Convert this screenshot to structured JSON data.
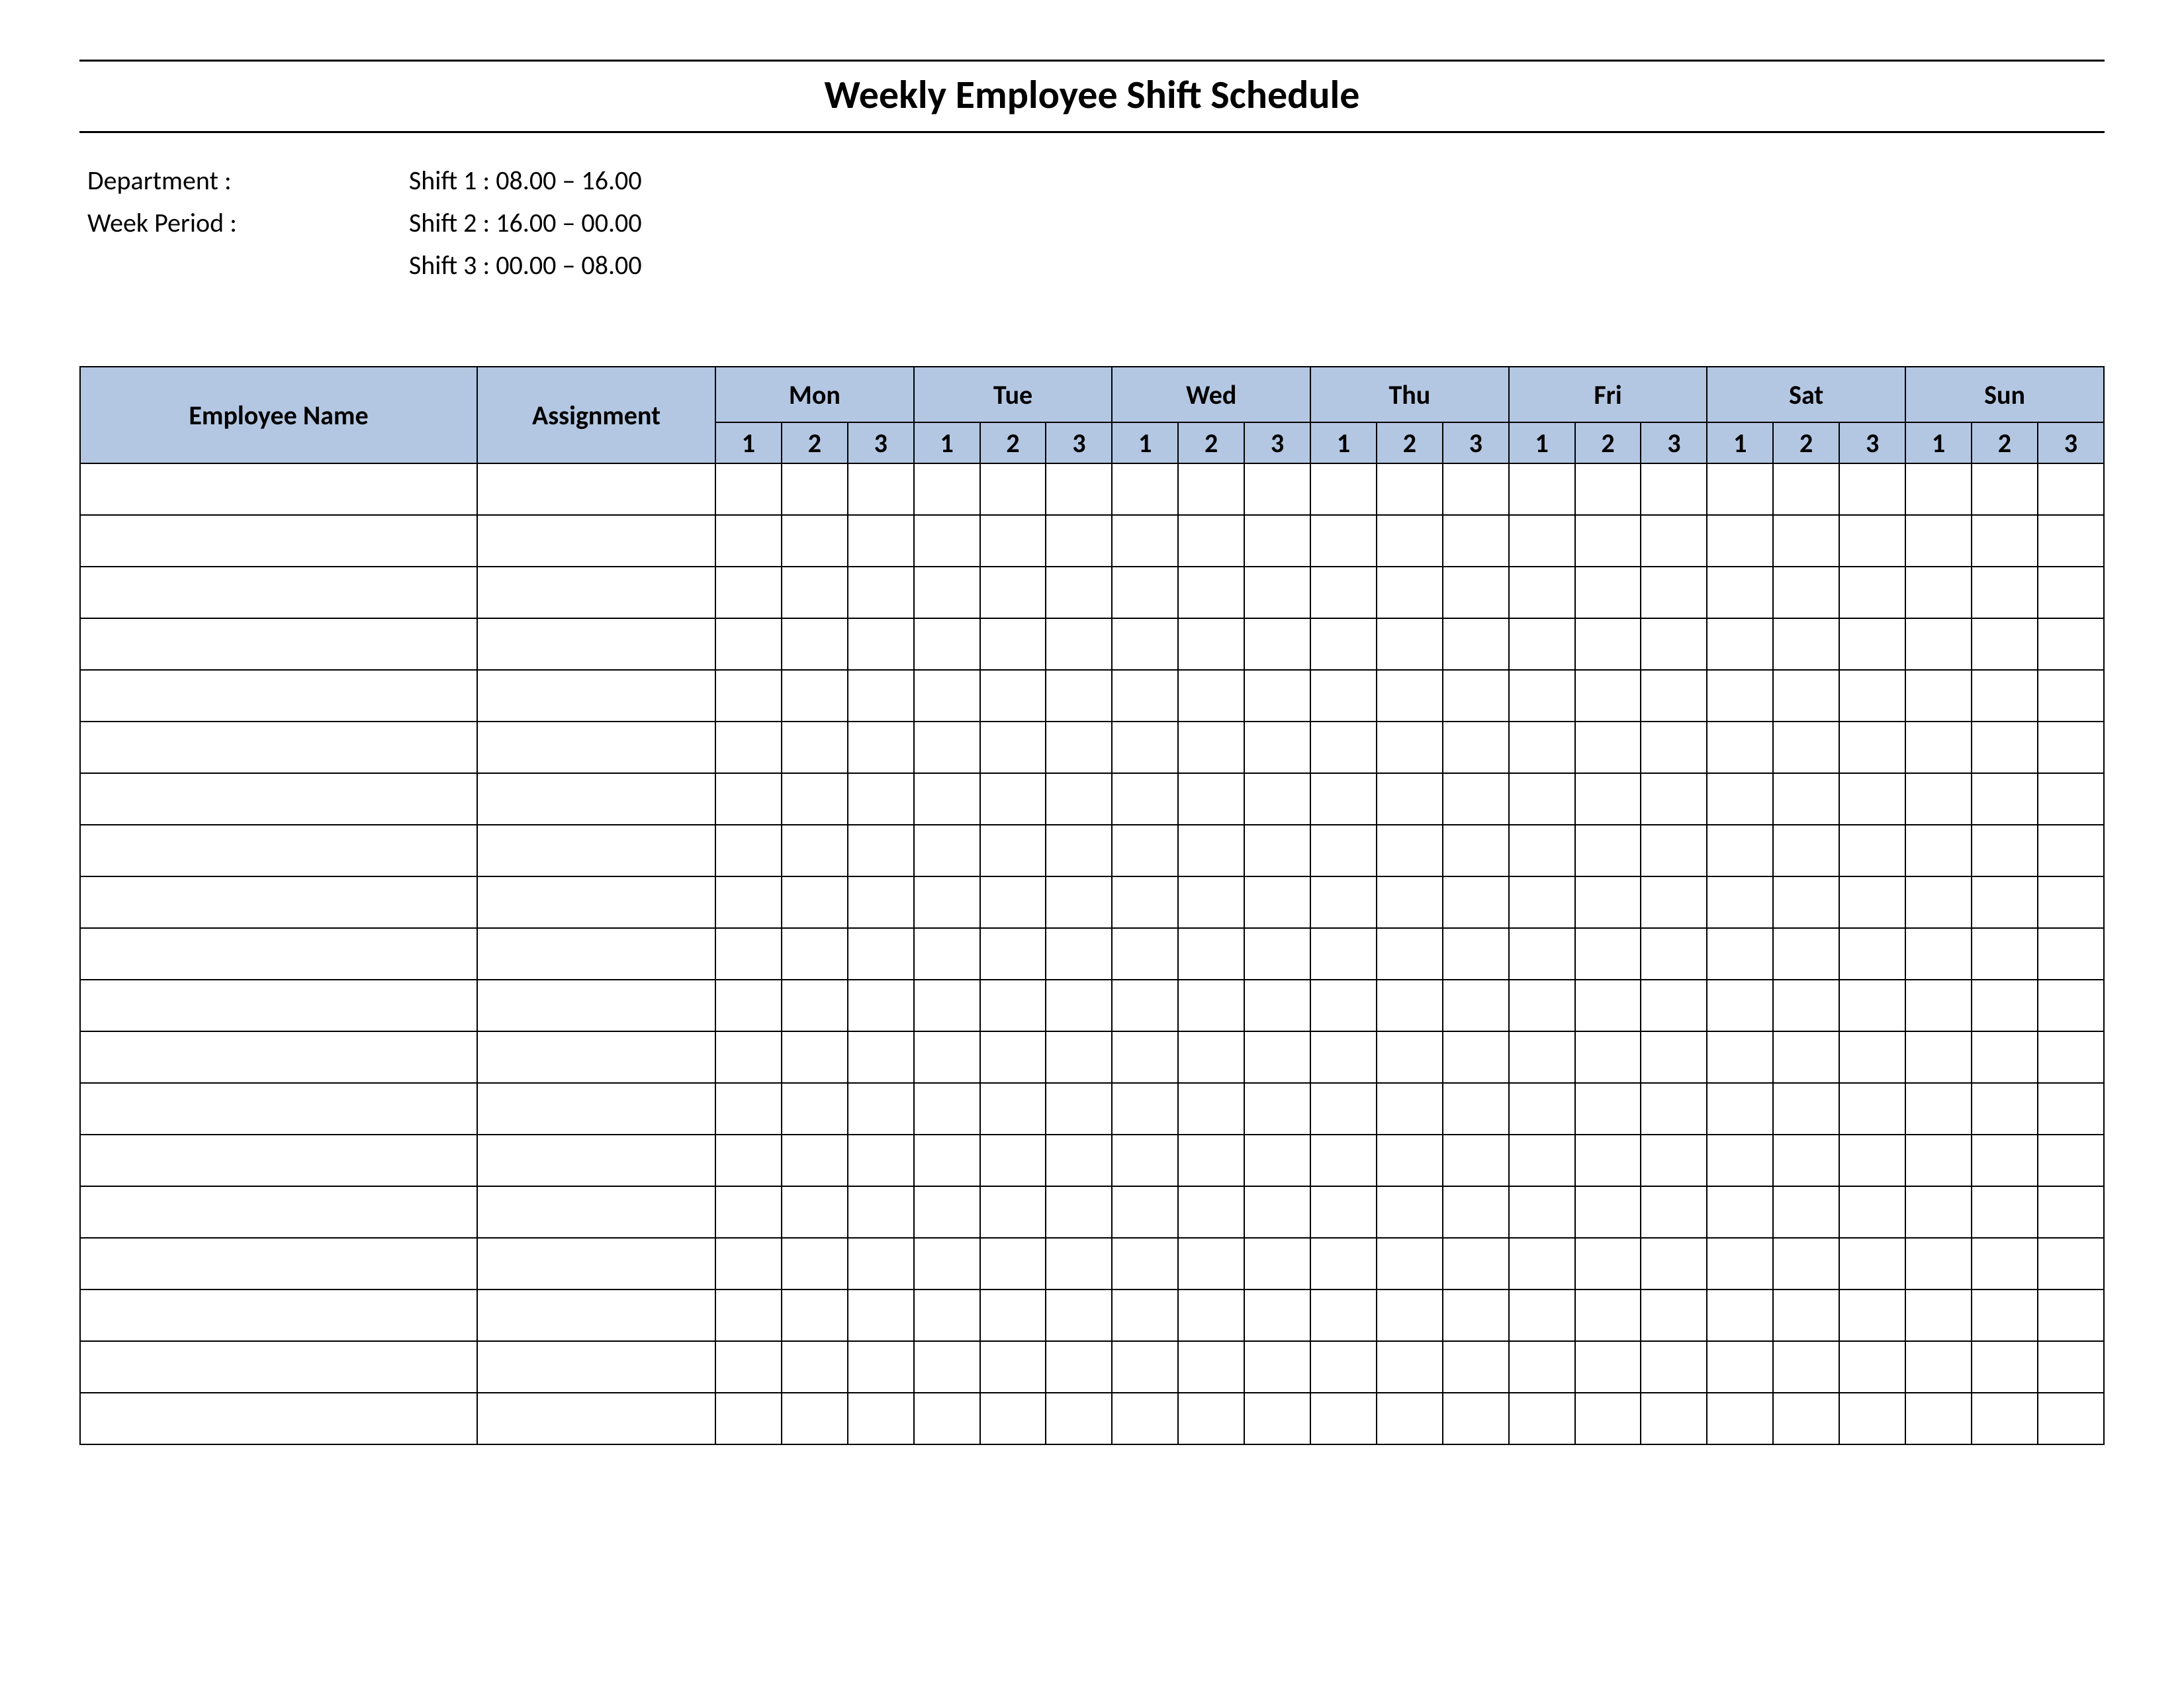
{
  "title": "Weekly Employee Shift Schedule",
  "meta": {
    "department_label": "Department    :",
    "week_period_label": "Week  Period :",
    "shift1": "Shift 1  : 08.00  – 16.00",
    "shift2": "Shift 2  : 16.00  – 00.00",
    "shift3": "Shift 3  : 00.00  – 08.00"
  },
  "headers": {
    "employee_name": "Employee Name",
    "assignment": "Assignment",
    "days": [
      "Mon",
      "Tue",
      "Wed",
      "Thu",
      "Fri",
      "Sat",
      "Sun"
    ],
    "shifts": [
      "1",
      "2",
      "3"
    ]
  },
  "row_count": 19
}
